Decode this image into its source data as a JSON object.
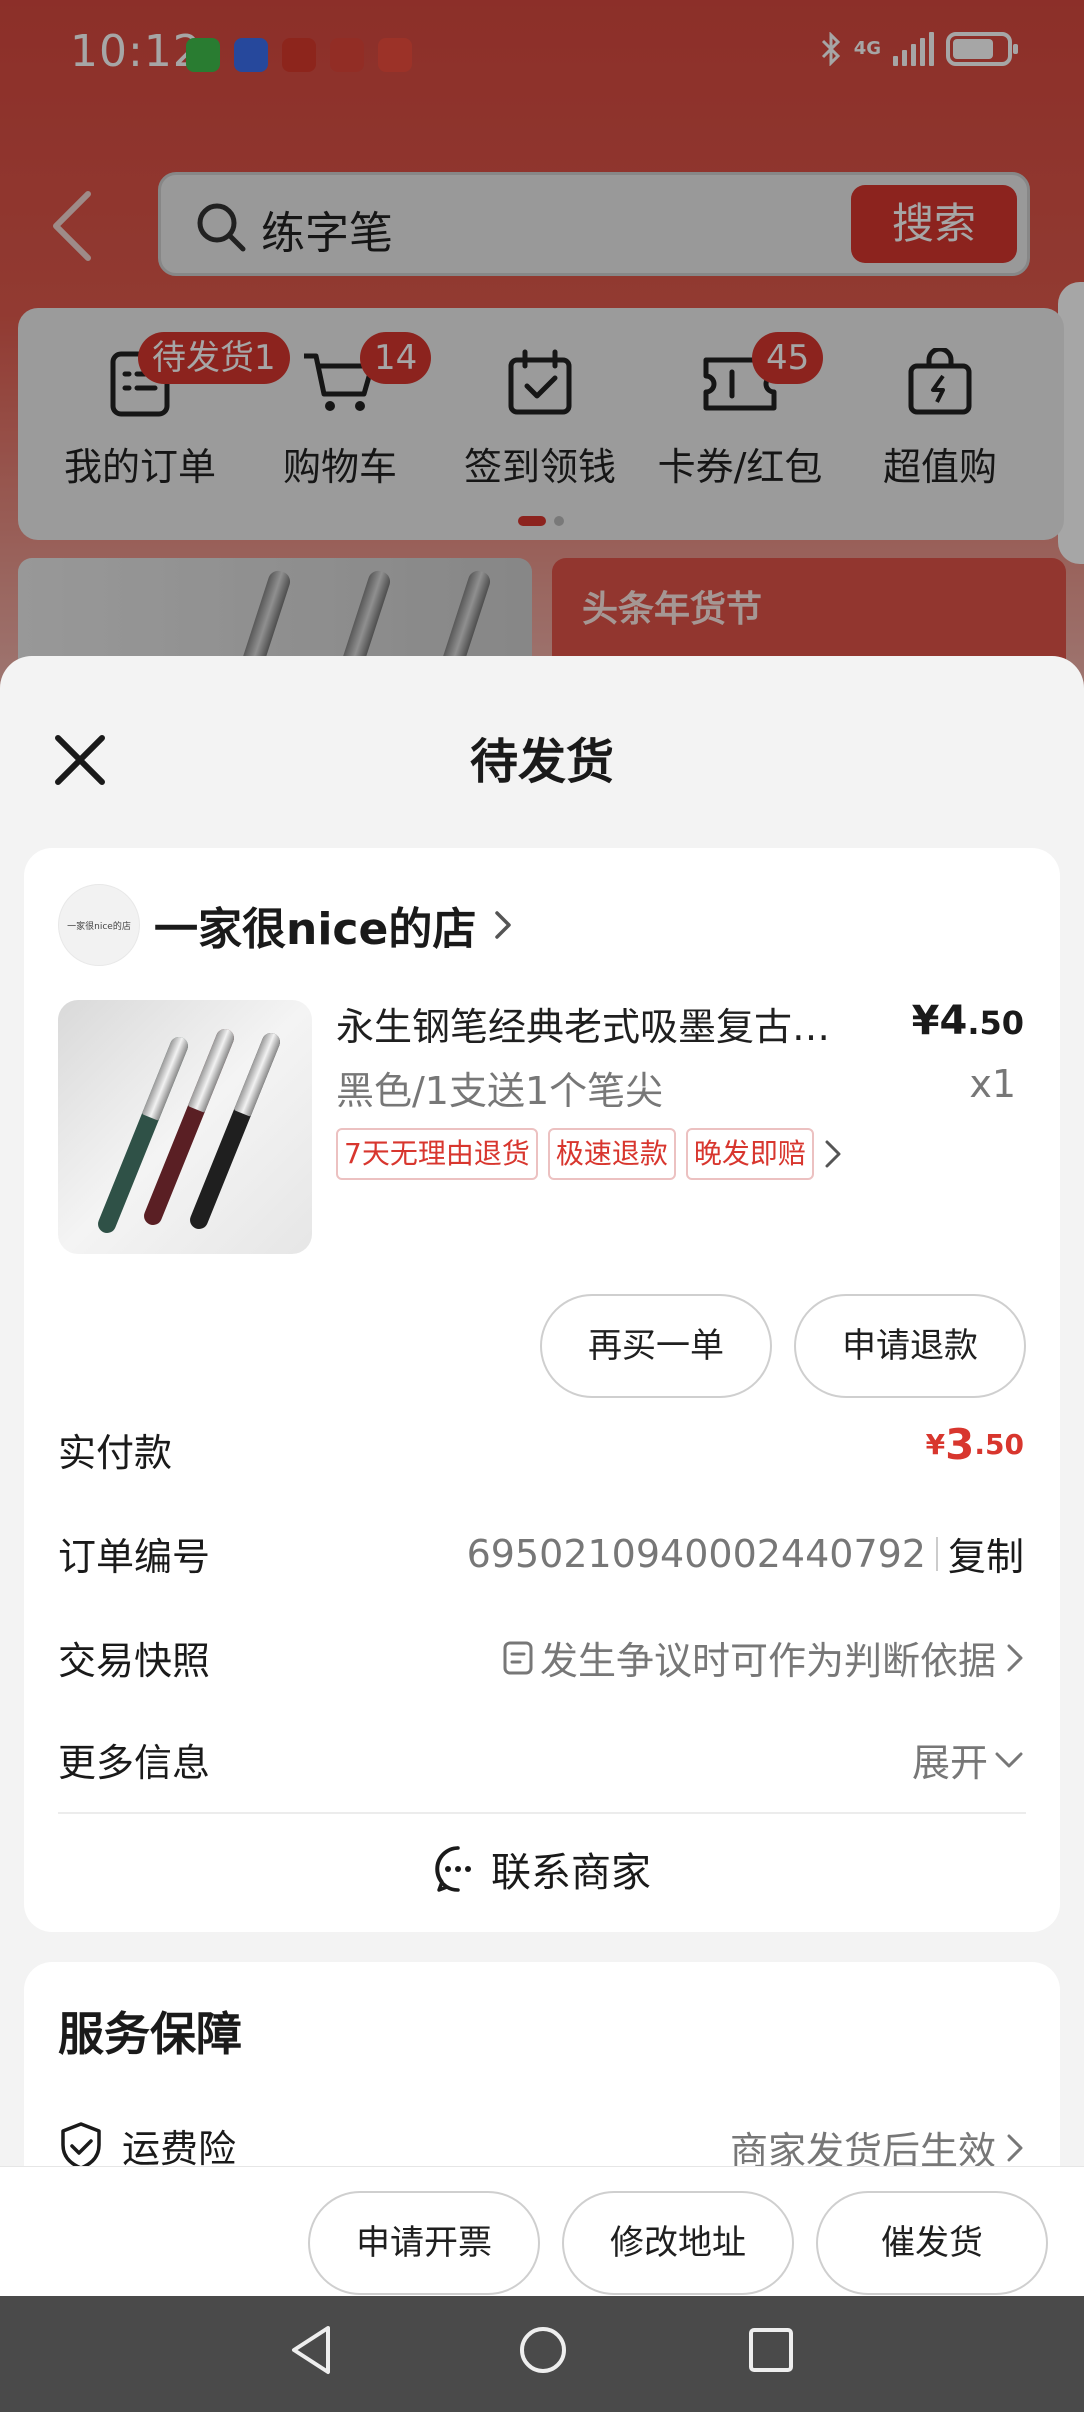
{
  "status_bar": {
    "time": "10:12",
    "network": "4G",
    "app_icon_colors": [
      "#3fbf4c",
      "#3b6ff0",
      "#d93a2b",
      "#e0463a",
      "#f04e3e"
    ]
  },
  "search": {
    "query": "练字笔",
    "button_label": "搜索"
  },
  "quick_menu": [
    {
      "label": "我的订单",
      "badge": "待发货1",
      "icon": "order-list-icon"
    },
    {
      "label": "购物车",
      "badge": "14",
      "icon": "shopping-cart-icon"
    },
    {
      "label": "签到领钱",
      "badge": "",
      "icon": "calendar-check-icon"
    },
    {
      "label": "卡券/红包",
      "badge": "45",
      "icon": "coupon-icon"
    },
    {
      "label": "超值购",
      "badge": "",
      "icon": "bag-bolt-icon"
    }
  ],
  "banner": {
    "right_title": "头条年货节"
  },
  "sheet": {
    "title": "待发货",
    "shop": {
      "avatar_text": "一家很nice的店",
      "name": "一家很nice的店"
    },
    "product": {
      "title": "永生钢笔经典老式吸墨复古…",
      "price_yen": "¥",
      "price_int": "4",
      "price_dec": ".50",
      "sku": "黑色/1支送1个笔尖",
      "quantity": "x1",
      "tags": [
        "7天无理由退货",
        "极速退款",
        "晚发即赔"
      ]
    },
    "actions": {
      "buy_again": "再买一单",
      "refund": "申请退款"
    },
    "rows": {
      "paid_label": "实付款",
      "paid_yen": "¥",
      "paid_int": "3",
      "paid_dec": ".50",
      "order_no_label": "订单编号",
      "order_no": "6950210940002440792",
      "copy_label": "复制",
      "snapshot_label": "交易快照",
      "snapshot_value": "发生争议时可作为判断依据",
      "more_label": "更多信息",
      "more_value": "展开"
    },
    "contact_label": "联系商家",
    "service": {
      "title": "服务保障",
      "item_label": "运费险",
      "item_value": "商家发货后生效"
    }
  },
  "bottom_bar": {
    "invoice": "申请开票",
    "modify_address": "修改地址",
    "urge_shipping": "催发货"
  },
  "colors": {
    "accent": "#d8362e",
    "background_red": "#d8493f"
  }
}
